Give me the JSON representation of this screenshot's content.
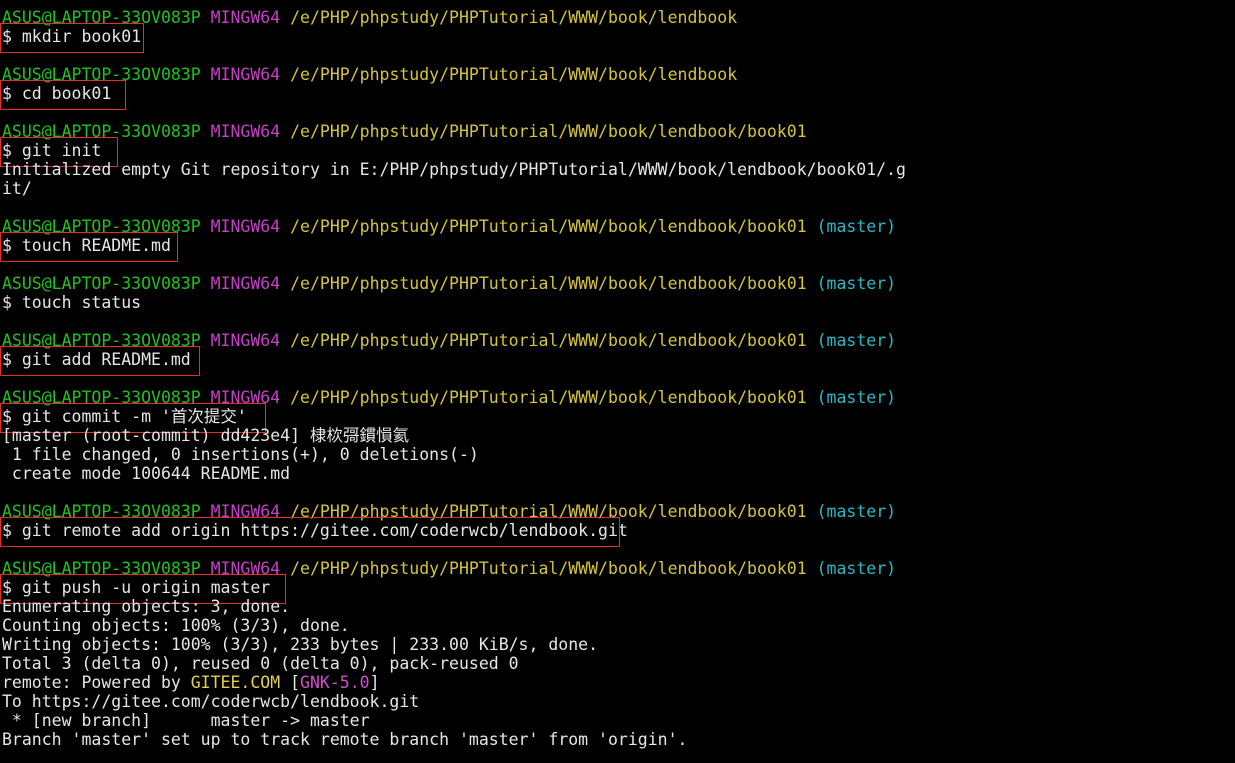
{
  "colors": {
    "background": "#000000",
    "user": "#1fc21f",
    "host": "#c440c4",
    "path": "#d4c43a",
    "branch": "#2ab8c6",
    "text": "#e6e6e6",
    "highlight_box": "#e0302e"
  },
  "lines": [
    {
      "segments": [
        {
          "t": "ASUS@LAPTOP-33OV083P",
          "c": "user"
        },
        {
          "t": " ",
          "c": "plain"
        },
        {
          "t": "MINGW64",
          "c": "host"
        },
        {
          "t": " /e/PHP/phpstudy/PHPTutorial/WWW/book/lendbook",
          "c": "path"
        }
      ]
    },
    {
      "segments": [
        {
          "t": "$ mkdir book01",
          "c": "plain"
        }
      ],
      "highlight": 144
    },
    {
      "segments": []
    },
    {
      "segments": [
        {
          "t": "ASUS@LAPTOP-33OV083P",
          "c": "user"
        },
        {
          "t": " ",
          "c": "plain"
        },
        {
          "t": "MINGW64",
          "c": "host"
        },
        {
          "t": " /e/PHP/phpstudy/PHPTutorial/WWW/book/lendbook",
          "c": "path"
        }
      ]
    },
    {
      "segments": [
        {
          "t": "$ cd book01",
          "c": "plain"
        }
      ],
      "highlight": 126
    },
    {
      "segments": []
    },
    {
      "segments": [
        {
          "t": "ASUS@LAPTOP-33OV083P",
          "c": "user"
        },
        {
          "t": " ",
          "c": "plain"
        },
        {
          "t": "MINGW64",
          "c": "host"
        },
        {
          "t": " /e/PHP/phpstudy/PHPTutorial/WWW/book/lendbook/book01",
          "c": "path"
        }
      ]
    },
    {
      "segments": [
        {
          "t": "$ git init",
          "c": "plain"
        }
      ],
      "highlight": 118
    },
    {
      "segments": [
        {
          "t": "Initialized empty Git repository in E:/PHP/phpstudy/PHPTutorial/WWW/book/lendbook/book01/.g",
          "c": "plain"
        }
      ]
    },
    {
      "segments": [
        {
          "t": "it/",
          "c": "plain"
        }
      ]
    },
    {
      "segments": []
    },
    {
      "segments": [
        {
          "t": "ASUS@LAPTOP-33OV083P",
          "c": "user"
        },
        {
          "t": " ",
          "c": "plain"
        },
        {
          "t": "MINGW64",
          "c": "host"
        },
        {
          "t": " /e/PHP/phpstudy/PHPTutorial/WWW/book/lendbook/book01",
          "c": "path"
        },
        {
          "t": " (master)",
          "c": "branch"
        }
      ]
    },
    {
      "segments": [
        {
          "t": "$ touch README.md",
          "c": "plain"
        }
      ],
      "highlight": 178
    },
    {
      "segments": []
    },
    {
      "segments": [
        {
          "t": "ASUS@LAPTOP-33OV083P",
          "c": "user"
        },
        {
          "t": " ",
          "c": "plain"
        },
        {
          "t": "MINGW64",
          "c": "host"
        },
        {
          "t": " /e/PHP/phpstudy/PHPTutorial/WWW/book/lendbook/book01",
          "c": "path"
        },
        {
          "t": " (master)",
          "c": "branch"
        }
      ]
    },
    {
      "segments": [
        {
          "t": "$ touch status",
          "c": "plain"
        }
      ]
    },
    {
      "segments": []
    },
    {
      "segments": [
        {
          "t": "ASUS@LAPTOP-33OV083P",
          "c": "user"
        },
        {
          "t": " ",
          "c": "plain"
        },
        {
          "t": "MINGW64",
          "c": "host"
        },
        {
          "t": " /e/PHP/phpstudy/PHPTutorial/WWW/book/lendbook/book01",
          "c": "path"
        },
        {
          "t": " (master)",
          "c": "branch"
        }
      ]
    },
    {
      "segments": [
        {
          "t": "$ git add README.md",
          "c": "plain"
        }
      ],
      "highlight": 200
    },
    {
      "segments": []
    },
    {
      "segments": [
        {
          "t": "ASUS@LAPTOP-33OV083P",
          "c": "user"
        },
        {
          "t": " ",
          "c": "plain"
        },
        {
          "t": "MINGW64",
          "c": "host"
        },
        {
          "t": " /e/PHP/phpstudy/PHPTutorial/WWW/book/lendbook/book01",
          "c": "path"
        },
        {
          "t": " (master)",
          "c": "branch"
        }
      ]
    },
    {
      "segments": [
        {
          "t": "$ git commit -m '首次提交'",
          "c": "plain"
        }
      ],
      "highlight": 266
    },
    {
      "segments": [
        {
          "t": "[master (root-commit) dd423e4] 棣栨彁鏆愪氦",
          "c": "plain"
        }
      ]
    },
    {
      "segments": [
        {
          "t": " 1 file changed, 0 insertions(+), 0 deletions(-)",
          "c": "plain"
        }
      ]
    },
    {
      "segments": [
        {
          "t": " create mode 100644 README.md",
          "c": "plain"
        }
      ]
    },
    {
      "segments": []
    },
    {
      "segments": [
        {
          "t": "ASUS@LAPTOP-33OV083P",
          "c": "user"
        },
        {
          "t": " ",
          "c": "plain"
        },
        {
          "t": "MINGW64",
          "c": "host"
        },
        {
          "t": " /e/PHP/phpstudy/PHPTutorial/WWW/book/lendbook/book01",
          "c": "path"
        },
        {
          "t": " (master)",
          "c": "branch"
        }
      ]
    },
    {
      "segments": [
        {
          "t": "$ git remote add origin https://gitee.com/coderwcb/lendbook.git",
          "c": "plain"
        }
      ],
      "highlight": 620
    },
    {
      "segments": []
    },
    {
      "segments": [
        {
          "t": "ASUS@LAPTOP-33OV083P",
          "c": "user"
        },
        {
          "t": " ",
          "c": "plain"
        },
        {
          "t": "MINGW64",
          "c": "host"
        },
        {
          "t": " /e/PHP/phpstudy/PHPTutorial/WWW/book/lendbook/book01",
          "c": "path"
        },
        {
          "t": " (master)",
          "c": "branch"
        }
      ]
    },
    {
      "segments": [
        {
          "t": "$ git push -u origin master",
          "c": "plain"
        }
      ],
      "highlight": 286
    },
    {
      "segments": [
        {
          "t": "Enumerating objects: 3, done.",
          "c": "plain"
        }
      ]
    },
    {
      "segments": [
        {
          "t": "Counting objects: 100% (3/3), done.",
          "c": "plain"
        }
      ]
    },
    {
      "segments": [
        {
          "t": "Writing objects: 100% (3/3), 233 bytes | 233.00 KiB/s, done.",
          "c": "plain"
        }
      ]
    },
    {
      "segments": [
        {
          "t": "Total 3 (delta 0), reused 0 (delta 0), pack-reused 0",
          "c": "plain"
        }
      ]
    },
    {
      "segments": [
        {
          "t": "remote: Powered by ",
          "c": "plain"
        },
        {
          "t": "GITEE.COM",
          "c": "yellow"
        },
        {
          "t": " [",
          "c": "plain"
        },
        {
          "t": "GNK-5.0",
          "c": "magenta"
        },
        {
          "t": "]",
          "c": "plain"
        }
      ]
    },
    {
      "segments": [
        {
          "t": "To https://gitee.com/coderwcb/lendbook.git",
          "c": "plain"
        }
      ]
    },
    {
      "segments": [
        {
          "t": " * [new branch]      master -> master",
          "c": "plain"
        }
      ]
    },
    {
      "segments": [
        {
          "t": "Branch 'master' set up to track remote branch 'master' from 'origin'.",
          "c": "plain"
        }
      ]
    }
  ]
}
